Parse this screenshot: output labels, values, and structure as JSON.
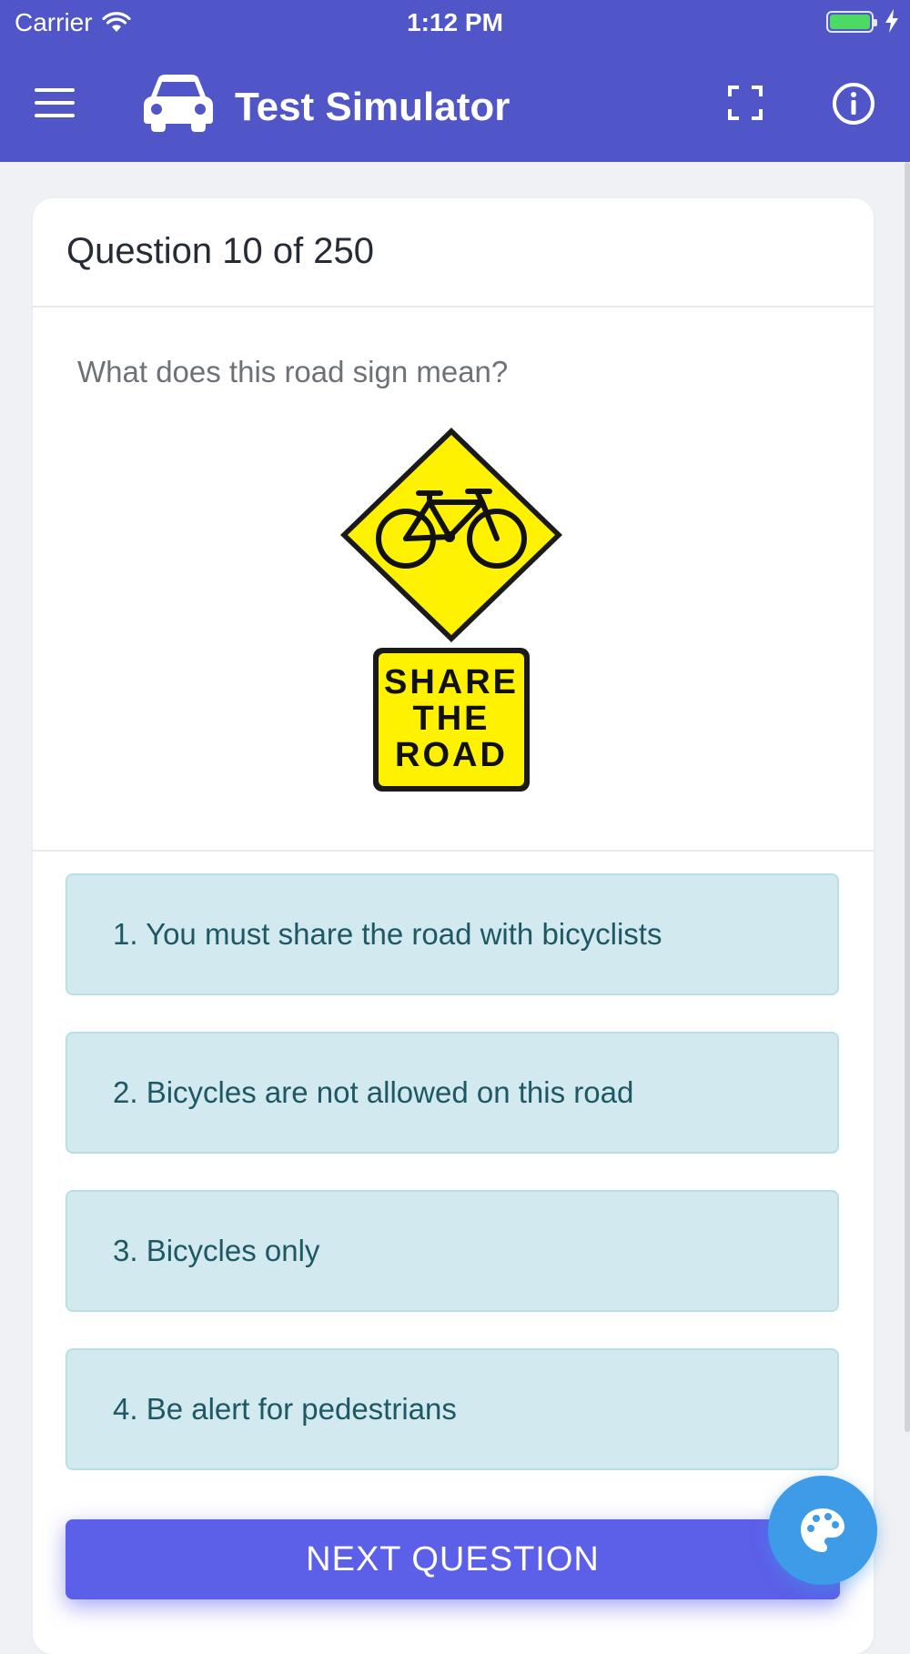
{
  "status_bar": {
    "carrier": "Carrier",
    "time": "1:12 PM"
  },
  "app_bar": {
    "title": "Test Simulator",
    "icons": [
      "menu-icon",
      "car-icon",
      "fullscreen-icon",
      "info-icon"
    ]
  },
  "question": {
    "header": "Question 10 of 250",
    "text": "What does this road sign mean?",
    "sign_text": [
      "SHARE",
      "THE",
      "ROAD"
    ]
  },
  "answers": [
    {
      "label": "1. You must share the road with bicyclists"
    },
    {
      "label": "2. Bicycles are not allowed on this road"
    },
    {
      "label": "3. Bicycles only"
    },
    {
      "label": "4. Be alert for pedestrians"
    }
  ],
  "next_button": {
    "label": "NEXT QUESTION"
  },
  "fab": {
    "icon": "palette-icon"
  },
  "colors": {
    "app_bar": "#5055c8",
    "answer_bg": "#d2eaef",
    "answer_text": "#1d5864",
    "next_button": "#5c5fe8",
    "fab": "#3d9be8",
    "sign_yellow": "#fff200"
  }
}
